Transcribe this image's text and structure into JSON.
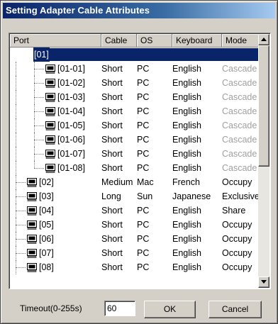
{
  "window": {
    "title": "Setting Adapter Cable Attributes"
  },
  "columns": [
    "Port",
    "Cable",
    "OS",
    "Keyboard",
    "Mode"
  ],
  "rows": [
    {
      "port": "[01]",
      "cable": "",
      "os": "",
      "keyboard": "",
      "mode": "",
      "level": 0,
      "icon": "hub-icon",
      "expanded": true,
      "selected": true,
      "mode_muted": false
    },
    {
      "port": "[01-01]",
      "cable": "Short",
      "os": "PC",
      "keyboard": "English",
      "mode": "Cascade",
      "level": 1,
      "icon": "computer-icon",
      "mode_muted": true
    },
    {
      "port": "[01-02]",
      "cable": "Short",
      "os": "PC",
      "keyboard": "English",
      "mode": "Cascade",
      "level": 1,
      "icon": "computer-icon",
      "mode_muted": true
    },
    {
      "port": "[01-03]",
      "cable": "Short",
      "os": "PC",
      "keyboard": "English",
      "mode": "Cascade",
      "level": 1,
      "icon": "computer-icon",
      "mode_muted": true
    },
    {
      "port": "[01-04]",
      "cable": "Short",
      "os": "PC",
      "keyboard": "English",
      "mode": "Cascade",
      "level": 1,
      "icon": "computer-icon",
      "mode_muted": true
    },
    {
      "port": "[01-05]",
      "cable": "Short",
      "os": "PC",
      "keyboard": "English",
      "mode": "Cascade",
      "level": 1,
      "icon": "computer-icon",
      "mode_muted": true
    },
    {
      "port": "[01-06]",
      "cable": "Short",
      "os": "PC",
      "keyboard": "English",
      "mode": "Cascade",
      "level": 1,
      "icon": "computer-icon",
      "mode_muted": true
    },
    {
      "port": "[01-07]",
      "cable": "Short",
      "os": "PC",
      "keyboard": "English",
      "mode": "Cascade",
      "level": 1,
      "icon": "computer-icon",
      "mode_muted": true
    },
    {
      "port": "[01-08]",
      "cable": "Short",
      "os": "PC",
      "keyboard": "English",
      "mode": "Cascade",
      "level": 1,
      "icon": "computer-icon",
      "mode_muted": true
    },
    {
      "port": "[02]",
      "cable": "Medium",
      "os": "Mac",
      "keyboard": "French",
      "mode": "Occupy",
      "level": 0,
      "icon": "computer-icon",
      "mode_muted": false
    },
    {
      "port": "[03]",
      "cable": "Long",
      "os": "Sun",
      "keyboard": "Japanese",
      "mode": "Exclusive",
      "level": 0,
      "icon": "computer-icon",
      "mode_muted": false
    },
    {
      "port": "[04]",
      "cable": "Short",
      "os": "PC",
      "keyboard": "English",
      "mode": "Share",
      "level": 0,
      "icon": "computer-icon",
      "mode_muted": false
    },
    {
      "port": "[05]",
      "cable": "Short",
      "os": "PC",
      "keyboard": "English",
      "mode": "Occupy",
      "level": 0,
      "icon": "computer-icon",
      "mode_muted": false
    },
    {
      "port": "[06]",
      "cable": "Short",
      "os": "PC",
      "keyboard": "English",
      "mode": "Occupy",
      "level": 0,
      "icon": "computer-icon",
      "mode_muted": false
    },
    {
      "port": "[07]",
      "cable": "Short",
      "os": "PC",
      "keyboard": "English",
      "mode": "Occupy",
      "level": 0,
      "icon": "computer-icon",
      "mode_muted": false
    },
    {
      "port": "[08]",
      "cable": "Short",
      "os": "PC",
      "keyboard": "English",
      "mode": "Occupy",
      "level": 0,
      "icon": "computer-icon",
      "mode_muted": false
    }
  ],
  "footer": {
    "timeout_label": "Timeout(0-255s)",
    "timeout_value": "60",
    "ok_label": "OK",
    "cancel_label": "Cancel"
  },
  "colors": {
    "title_start": "#0a246a",
    "title_end": "#a6caf0",
    "selection": "#0a246a",
    "muted_text": "#a0a0a0",
    "face": "#d4d0c8"
  }
}
